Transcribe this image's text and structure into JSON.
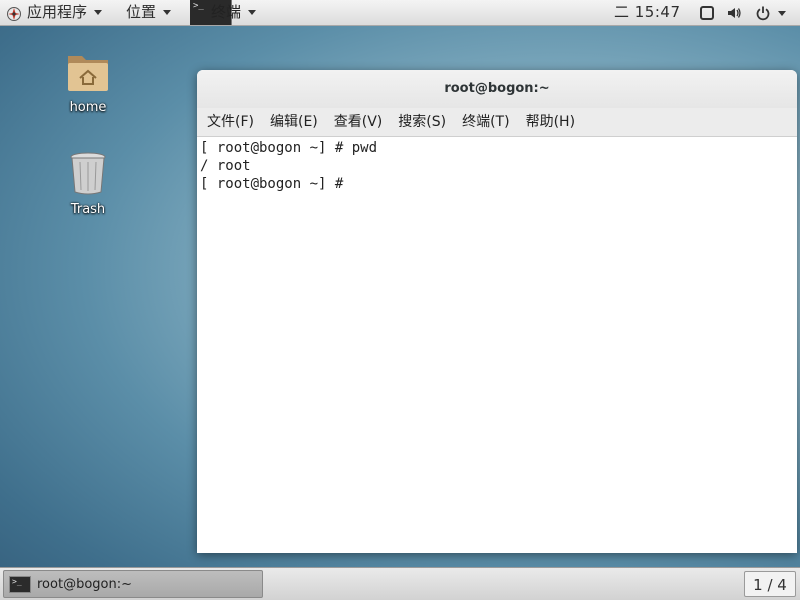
{
  "top_panel": {
    "apps_menu_label": "应用程序",
    "places_menu_label": "位置",
    "terminal_tab_label": "终端",
    "clock": "二 15:47"
  },
  "desktop": {
    "icons": [
      {
        "label": "home",
        "icon": "folder-home-icon"
      },
      {
        "label": "Trash",
        "icon": "trash-icon"
      }
    ]
  },
  "terminal_window": {
    "title": "root@bogon:~",
    "menu": [
      "文件(F)",
      "编辑(E)",
      "查看(V)",
      "搜索(S)",
      "终端(T)",
      "帮助(H)"
    ],
    "lines": [
      "[ root@bogon ~] # pwd",
      "/ root",
      "[ root@bogon ~] # "
    ]
  },
  "bottom_panel": {
    "task_label": "root@bogon:~",
    "workspace": "1 / 4"
  },
  "colors": {
    "panel": "#e0e0e0",
    "terminal_bg": "#ffffff",
    "desktop_blue": "#5b8ea8"
  }
}
